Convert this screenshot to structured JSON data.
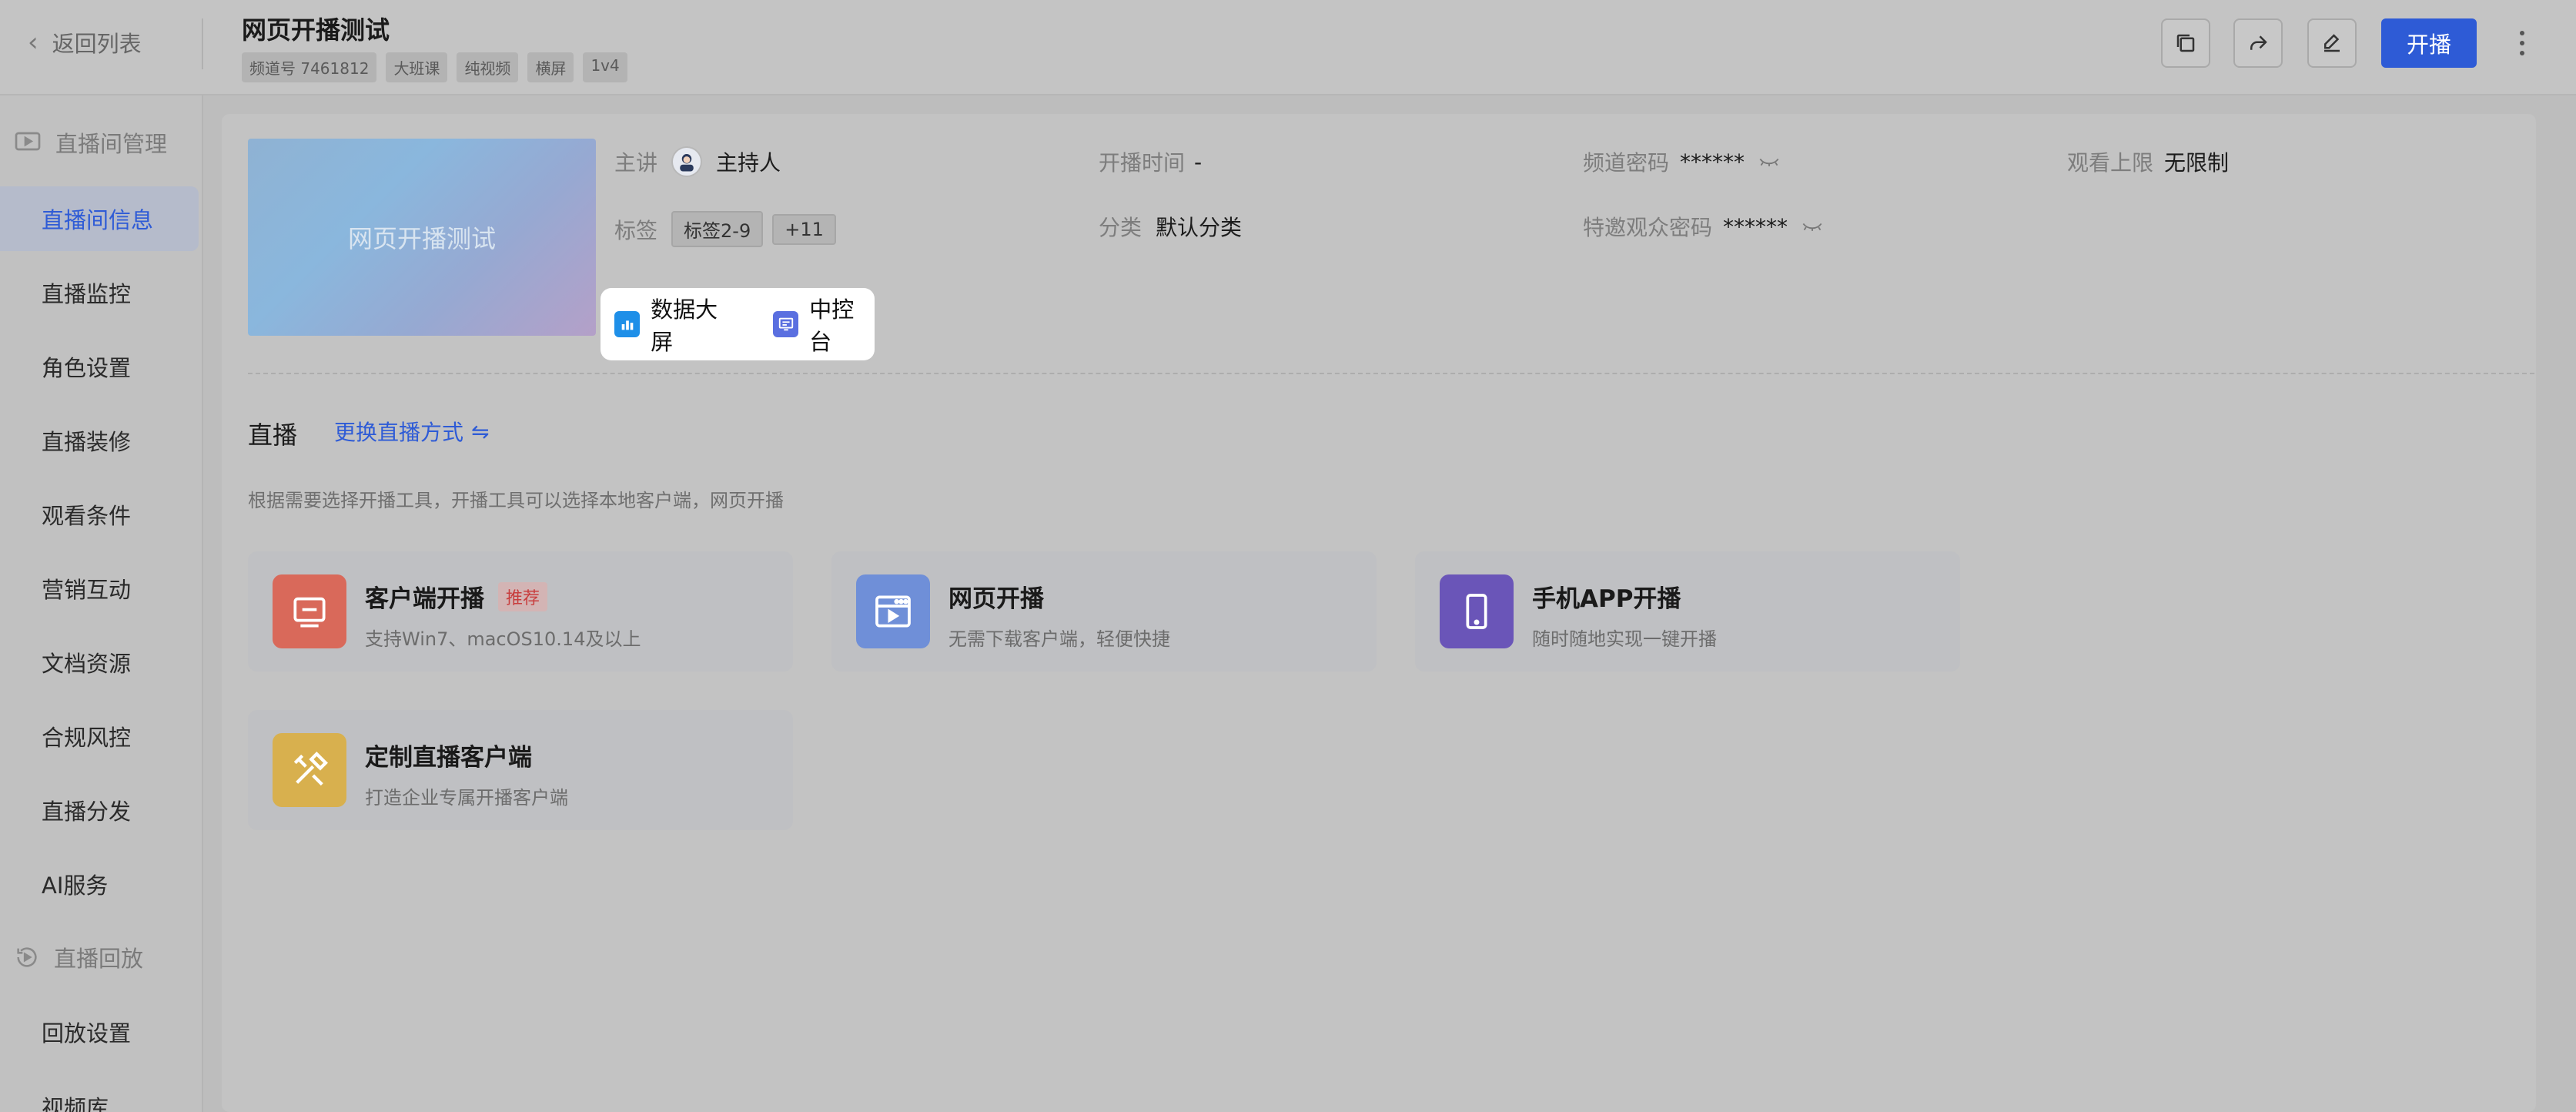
{
  "header": {
    "back_label": "返回列表",
    "title": "网页开播测试",
    "tags": [
      "频道号 7461812",
      "大班课",
      "纯视频",
      "横屏",
      "1v4"
    ],
    "start_label": "开播"
  },
  "sidebar": {
    "group1": "直播间管理",
    "items1": [
      "直播间信息",
      "直播监控",
      "角色设置",
      "直播装修",
      "观看条件",
      "营销互动",
      "文档资源",
      "合规风控",
      "直播分发",
      "AI服务"
    ],
    "group2": "直播回放",
    "items2": [
      "回放设置",
      "视频库"
    ]
  },
  "room": {
    "cover_text": "网页开播测试",
    "host_label": "主讲",
    "host_name": "主持人",
    "tag_label": "标签",
    "tag_value": "标签2-9",
    "tag_more": "+11",
    "start_time_label": "开播时间",
    "start_time_value": "-",
    "category_label": "分类",
    "category_value": "默认分类",
    "pwd_label": "频道密码",
    "pwd_value": "******",
    "vip_pwd_label": "特邀观众密码",
    "vip_pwd_value": "******",
    "limit_label": "观看上限",
    "limit_value": "无限制"
  },
  "popup": {
    "data_screen": "数据大屏",
    "control": "中控台"
  },
  "live": {
    "heading": "直播",
    "switch_label": "更换直播方式",
    "description": "根据需要选择开播工具，开播工具可以选择本地客户端，网页开播",
    "cards": [
      {
        "title": "客户端开播",
        "badge": "推荐",
        "desc": "支持Win7、macOS10.14及以上",
        "color": "#d9695a"
      },
      {
        "title": "网页开播",
        "badge": "",
        "desc": "无需下载客户端，轻便快捷",
        "color": "#6f8fd8"
      },
      {
        "title": "手机APP开播",
        "badge": "",
        "desc": "随时随地实现一键开播",
        "color": "#6a55b8"
      },
      {
        "title": "定制直播客户端",
        "badge": "",
        "desc": "打造企业专属开播客户端",
        "color": "#d8b04e"
      }
    ]
  },
  "colors": {
    "accent": "#2e5bd6"
  }
}
